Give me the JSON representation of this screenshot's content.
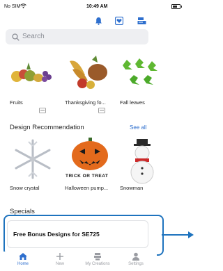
{
  "status_bar": {
    "carrier": "No SIM",
    "time": "10:49 AM"
  },
  "search": {
    "placeholder": "Search"
  },
  "categories": [
    {
      "label": "Fruits"
    },
    {
      "label": "Thanksgiving fo..."
    },
    {
      "label": "Fall leaves"
    }
  ],
  "recommendation": {
    "title": "Design Recommendation",
    "see_all": "See all",
    "items": [
      {
        "label": "Snow crystal"
      },
      {
        "label": "Halloween pump..."
      },
      {
        "label": "Snowman"
      }
    ],
    "pumpkin_text": "TRICK OR TREAT"
  },
  "specials": {
    "title": "Specials",
    "card_text": "Free Bonus Designs for SE725"
  },
  "tabs": [
    {
      "label": "Home",
      "active": true
    },
    {
      "label": "New",
      "active": false
    },
    {
      "label": "My Creations",
      "active": false
    },
    {
      "label": "Settings",
      "active": false
    }
  ],
  "colors": {
    "accent": "#2e6fce",
    "highlight": "#1e73be"
  }
}
